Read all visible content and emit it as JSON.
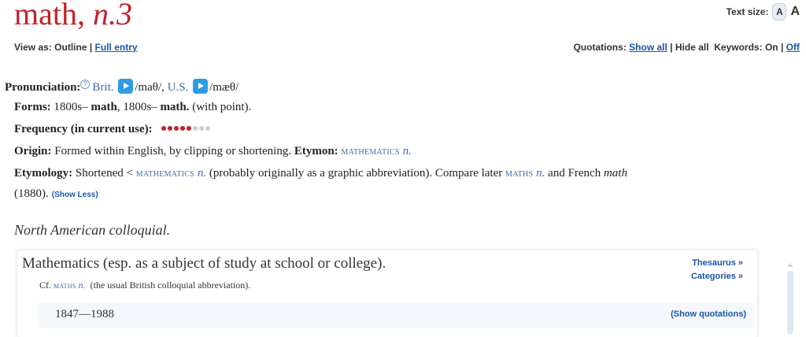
{
  "headword": {
    "word": "math,",
    "pos": "n.3"
  },
  "text_size": {
    "label": "Text size:",
    "small": "A",
    "large": "A"
  },
  "view": {
    "label": "View as:",
    "outline": "Outline",
    "sep": "|",
    "full_entry": "Full entry"
  },
  "quotations": {
    "label": "Quotations:",
    "show_all": "Show all",
    "sep": "|",
    "hide_all": "Hide all"
  },
  "keywords": {
    "label": "Keywords:",
    "on": "On",
    "sep": "|",
    "off": "Off"
  },
  "pronunciation": {
    "label": "Pronunciation:",
    "help": "?",
    "brit_label": "Brit.",
    "brit_ipa": "/maθ/,",
    "us_label": "U.S.",
    "us_ipa": "/mæθ/"
  },
  "forms": {
    "label": "Forms:",
    "f1_date": "1800s–",
    "f1_word": "math",
    "sep": ",",
    "f2_date": "1800s–",
    "f2_word": "math.",
    "note": "(with point)."
  },
  "frequency": {
    "label": "Frequency (in current use):",
    "filled": 5,
    "total": 8
  },
  "origin": {
    "label": "Origin:",
    "text": "Formed within English, by clipping or shortening.",
    "etymon_label": "Etymon:",
    "etymon_word": "mathematics",
    "etymon_pos": "n."
  },
  "etymology": {
    "label": "Etymology:",
    "t1": "Shortened <",
    "w1": "mathematics",
    "p1": "n.",
    "t2": "(probably originally as a graphic abbreviation). Compare later",
    "w2": "maths",
    "p2": "n.",
    "t3": "and French",
    "w3": "math",
    "t4": "(1880).",
    "show_less": "(Show Less)"
  },
  "usage": "North American colloquial.",
  "sense": {
    "definition": "Mathematics (esp. as a subject of study at school or college).",
    "cf_label": "Cf.",
    "cf_word": "maths",
    "cf_pos": "n.",
    "cf_note": "(the usual British colloquial abbreviation).",
    "thesaurus": "Thesaurus »",
    "categories": "Categories »",
    "date_range": "1847—1988",
    "show_quotations": "(Show quotations)"
  },
  "colors": {
    "headword": "#c0232c",
    "link": "#1a56a8",
    "play": "#2e9be3"
  }
}
